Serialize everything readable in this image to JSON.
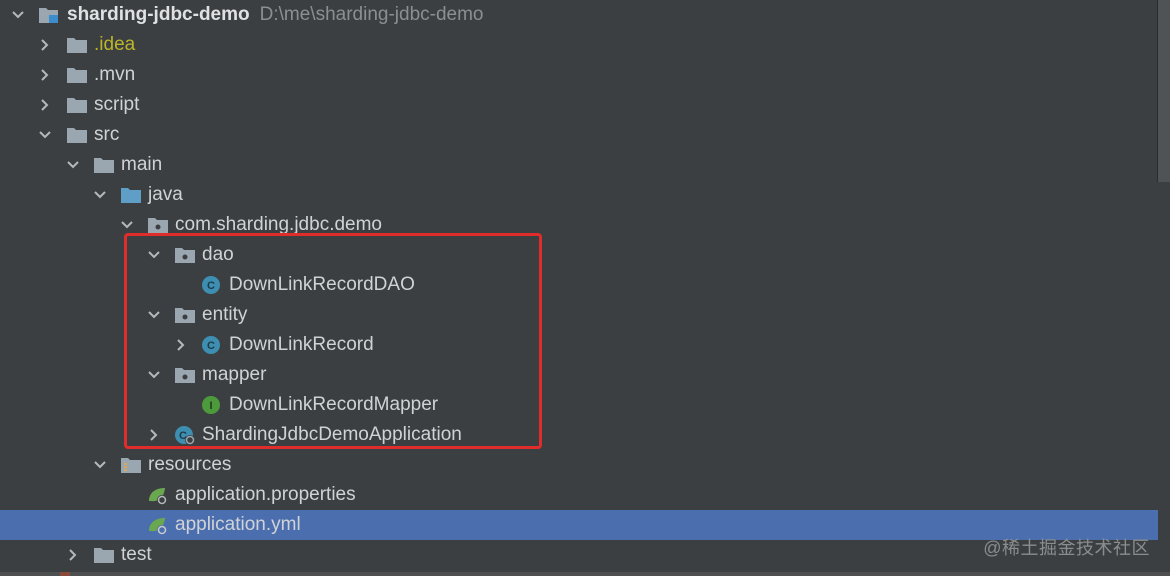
{
  "tree": {
    "root": {
      "name": "sharding-jdbc-demo",
      "path": "D:\\me\\sharding-jdbc-demo"
    },
    "items": [
      {
        "label": ".idea"
      },
      {
        "label": ".mvn"
      },
      {
        "label": "script"
      },
      {
        "label": "src"
      },
      {
        "label": "main"
      },
      {
        "label": "java"
      },
      {
        "label": "com.sharding.jdbc.demo"
      },
      {
        "label": "dao"
      },
      {
        "label": "DownLinkRecordDAO"
      },
      {
        "label": "entity"
      },
      {
        "label": "DownLinkRecord"
      },
      {
        "label": "mapper"
      },
      {
        "label": "DownLinkRecordMapper"
      },
      {
        "label": "ShardingJdbcDemoApplication"
      },
      {
        "label": "resources"
      },
      {
        "label": "application.properties"
      },
      {
        "label": "application.yml"
      },
      {
        "label": "test"
      }
    ],
    "selected": "application.yml"
  },
  "watermark": "@稀土掘金技术社区",
  "colors": {
    "background": "#3c3f41",
    "selection": "#4b6eaf",
    "highlight_border": "#e12c2c",
    "folder": "#9aa7b0",
    "source_folder": "#5f9fc7",
    "class_icon": "#3d8eb0",
    "interface_icon": "#4c9a3c",
    "spring_icon": "#6aa84f"
  },
  "icons": {
    "chevron_expanded": "chevron-down-icon",
    "chevron_collapsed": "chevron-right-icon",
    "folder": "folder-icon",
    "module": "module-icon",
    "package": "package-icon",
    "source_root": "source-folder-icon",
    "resources_root": "resources-folder-icon",
    "class": "class-icon",
    "interface": "interface-icon",
    "spring_boot_app": "spring-boot-class-icon",
    "spring_config": "spring-config-icon"
  }
}
